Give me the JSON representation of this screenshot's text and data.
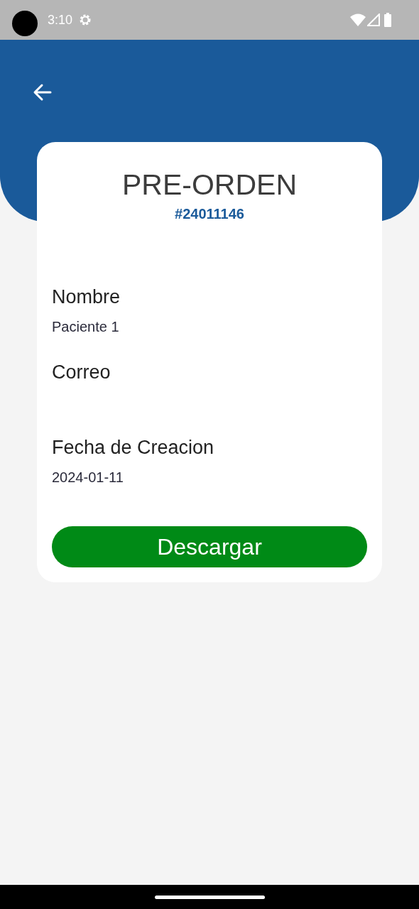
{
  "status_bar": {
    "time": "3:10"
  },
  "card": {
    "title": "PRE-ORDEN",
    "order_number": "#24011146",
    "fields": [
      {
        "label": "Nombre",
        "value": "Paciente 1"
      },
      {
        "label": "Correo"
      },
      {
        "label": "Fecha de Creacion",
        "value": "2024-01-11"
      }
    ],
    "button": "Descargar"
  }
}
